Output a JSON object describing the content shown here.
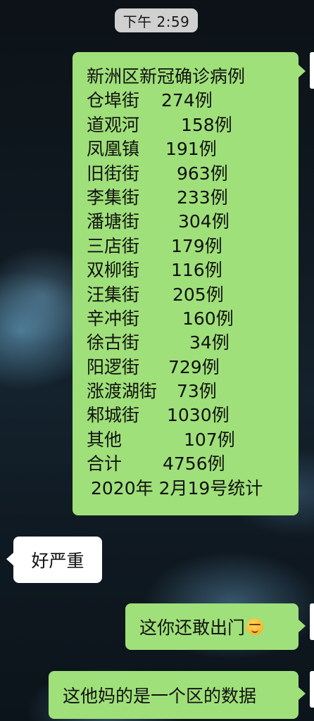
{
  "status": {
    "time": "下午 2:59"
  },
  "messages": {
    "stats": {
      "title": "新洲区新冠确诊病例",
      "rows": [
        {
          "name": "仓埠街",
          "count": "274例"
        },
        {
          "name": "道观河",
          "count": "158例"
        },
        {
          "name": "凤凰镇",
          "count": "191例"
        },
        {
          "name": "旧街街",
          "count": "963例"
        },
        {
          "name": "李集街",
          "count": "233例"
        },
        {
          "name": "潘塘街",
          "count": "304例"
        },
        {
          "name": "三店街",
          "count": "179例"
        },
        {
          "name": "双柳街",
          "count": "116例"
        },
        {
          "name": "汪集街",
          "count": "205例"
        },
        {
          "name": "辛冲街",
          "count": "160例"
        },
        {
          "name": "徐古街",
          "count": "34例"
        },
        {
          "name": "阳逻街",
          "count": "729例"
        },
        {
          "name": "涨渡湖街",
          "count": "73例"
        },
        {
          "name": "邾城街",
          "count": "1030例"
        },
        {
          "name": "其他",
          "count": "107例"
        },
        {
          "name": "合计",
          "count": "4756例"
        }
      ],
      "footer": "2020年 2月19号统计"
    },
    "reply_serious": "好严重",
    "reply_go_out": "这你还敢出门",
    "reply_district": "这他妈的是一个区的数据"
  },
  "icons": {
    "emoji": "smirk-emoji-icon"
  },
  "colors": {
    "sent_bubble": "#a0e07a",
    "received_bubble": "#ffffff",
    "time_pill": "#d0d0d0"
  }
}
